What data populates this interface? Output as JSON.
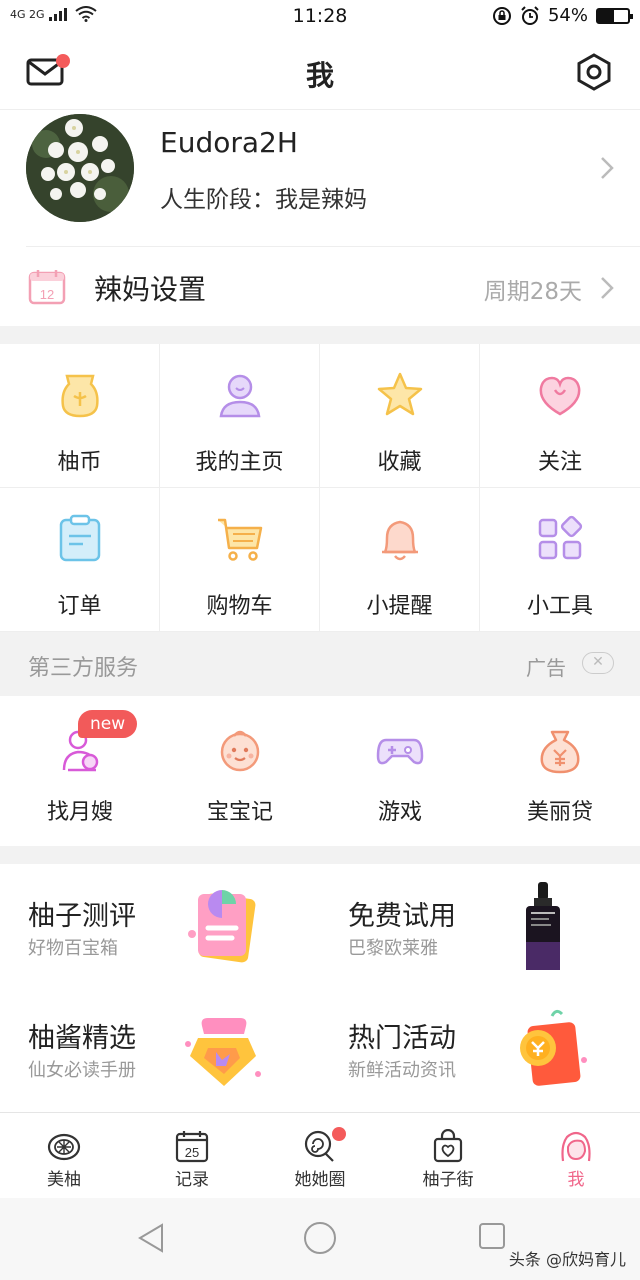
{
  "status_bar": {
    "network": "4G 2G",
    "time": "11:28",
    "battery": "54%",
    "battery_level": 0.54
  },
  "header": {
    "title": "我",
    "mail_has_badge": true
  },
  "profile": {
    "username": "Eudora2H",
    "stage": "人生阶段：我是辣妈"
  },
  "mom_settings": {
    "label": "辣妈设置",
    "value": "周期28天",
    "icon_day": "12"
  },
  "grid": [
    {
      "label": "柚币",
      "icon": "coin-bag-icon",
      "color": "#f5c24a"
    },
    {
      "label": "我的主页",
      "icon": "person-icon",
      "color": "#b58ee8"
    },
    {
      "label": "收藏",
      "icon": "star-icon",
      "color": "#f5c24a"
    },
    {
      "label": "关注",
      "icon": "heart-icon",
      "color": "#f07aa0"
    },
    {
      "label": "订单",
      "icon": "clipboard-icon",
      "color": "#6cc3e8"
    },
    {
      "label": "购物车",
      "icon": "cart-icon",
      "color": "#f5b04a"
    },
    {
      "label": "小提醒",
      "icon": "bell-icon",
      "color": "#f39a7a"
    },
    {
      "label": "小工具",
      "icon": "apps-icon",
      "color": "#b58ee8"
    }
  ],
  "third_party": {
    "title": "第三方服务",
    "ad_label": "广告",
    "items": [
      {
        "label": "找月嫂",
        "icon": "nanny-icon",
        "badge": "new"
      },
      {
        "label": "宝宝记",
        "icon": "baby-face-icon"
      },
      {
        "label": "游戏",
        "icon": "gamepad-icon"
      },
      {
        "label": "美丽贷",
        "icon": "money-bag-icon"
      }
    ]
  },
  "features": [
    {
      "title": "柚子测评",
      "subtitle": "好物百宝箱"
    },
    {
      "title": "免费试用",
      "subtitle": "巴黎欧莱雅"
    },
    {
      "title": "柚酱精选",
      "subtitle": "仙女必读手册"
    },
    {
      "title": "热门活动",
      "subtitle": "新鲜活动资讯"
    }
  ],
  "tabbar": [
    {
      "label": "美柚",
      "icon": "pomelo-icon",
      "active": false
    },
    {
      "label": "记录",
      "icon": "calendar-icon",
      "day": "25",
      "active": false
    },
    {
      "label": "她她圈",
      "icon": "lollipop-icon",
      "badge": true,
      "active": false
    },
    {
      "label": "柚子街",
      "icon": "shopping-bag-icon",
      "active": false
    },
    {
      "label": "我",
      "icon": "girl-icon",
      "active": true
    }
  ],
  "watermark": "头条 @欣妈育儿",
  "colors": {
    "accent": "#f0668a",
    "badge": "#f45b5b",
    "muted": "#999999"
  }
}
